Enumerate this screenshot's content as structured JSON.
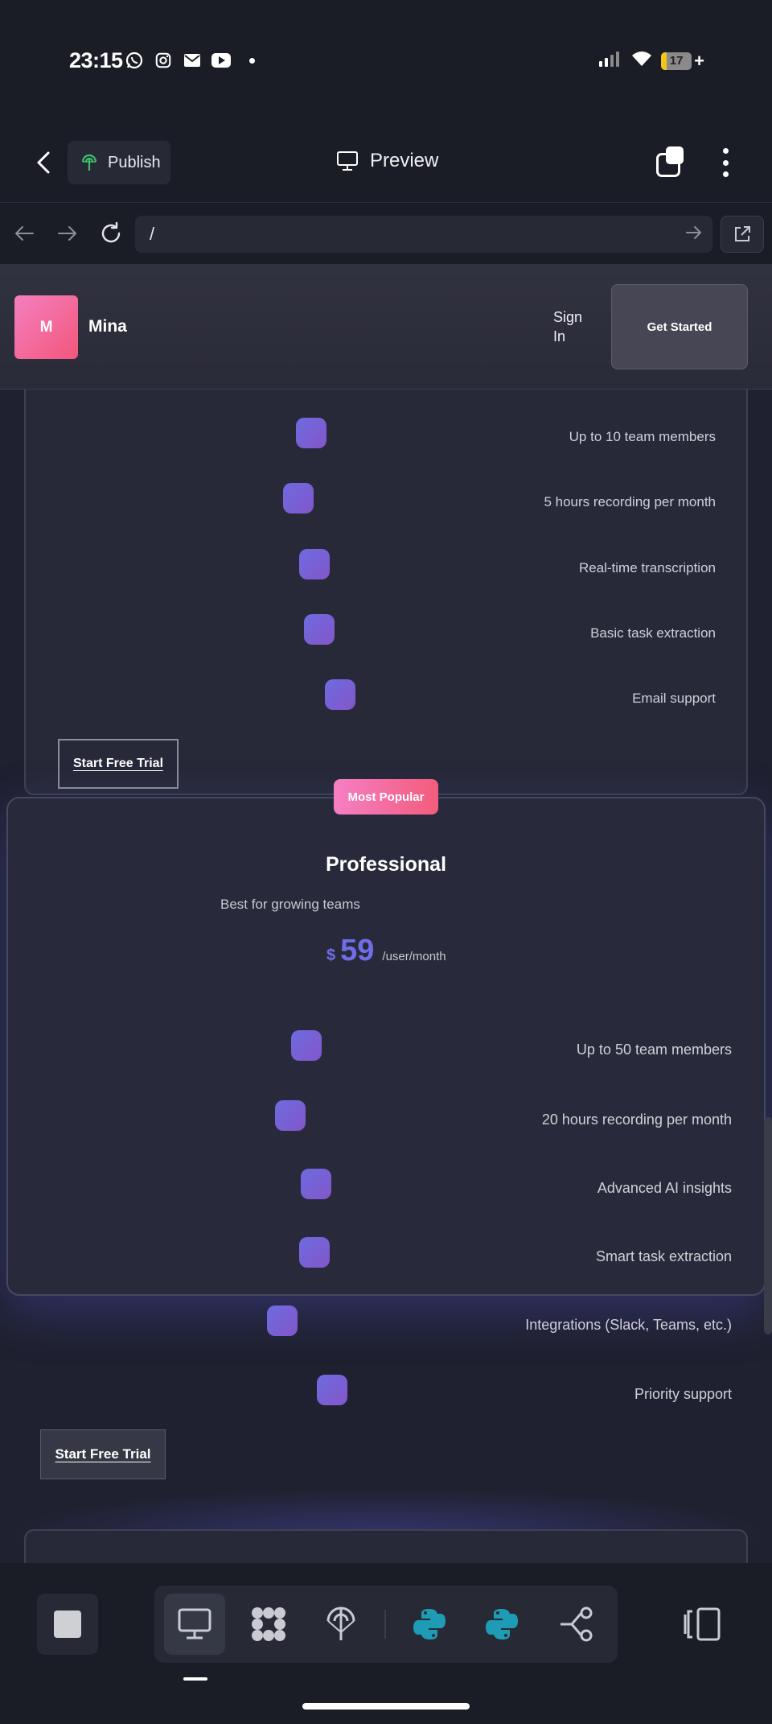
{
  "status_bar": {
    "time": "23:15",
    "notification_icons": [
      "whatsapp-icon",
      "instagram-icon",
      "mail-icon",
      "youtube-icon"
    ],
    "battery_level": "17",
    "battery_fraction": 0.17
  },
  "toolbar": {
    "publish_label": "Publish",
    "preview_label": "Preview"
  },
  "browser": {
    "url": "/"
  },
  "site": {
    "logo_letter": "M",
    "brand": "Mina",
    "signin_label": "Sign In",
    "get_started_label": "Get Started"
  },
  "plans": [
    {
      "features": [
        "Up to 10 team members",
        "5 hours recording per month",
        "Real-time transcription",
        "Basic task extraction",
        "Email support"
      ],
      "cta": "Start Free Trial"
    },
    {
      "badge": "Most Popular",
      "name": "Professional",
      "description": "Best for growing teams",
      "currency": "$",
      "price": "59",
      "period": "/user/month",
      "features": [
        "Up to 50 team members",
        "20 hours recording per month",
        "Advanced AI insights",
        "Smart task extraction",
        "Integrations (Slack, Teams, etc.)",
        "Priority support"
      ],
      "cta": "Start Free Trial"
    }
  ],
  "dock": {
    "items": [
      "desktop-preview-icon",
      "apps-icon",
      "deploy-icon",
      "python-icon",
      "python-icon",
      "workflow-icon"
    ],
    "accent_python": "#1e9bb5"
  }
}
